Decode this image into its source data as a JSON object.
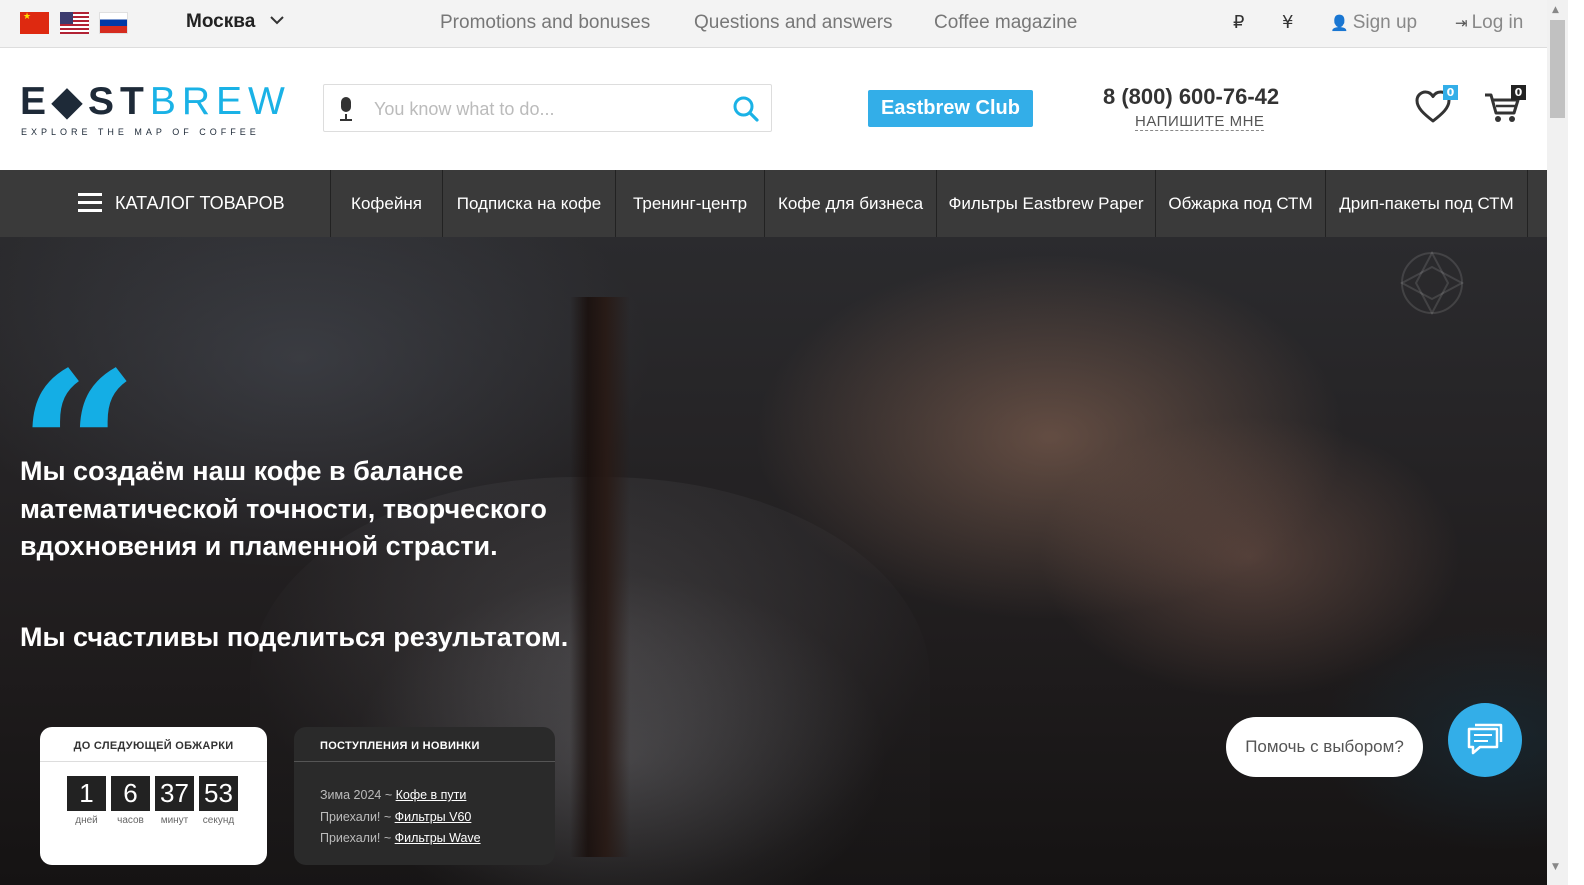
{
  "topbar": {
    "languages": [
      {
        "name": "cn-flag-icon"
      },
      {
        "name": "us-flag-icon"
      },
      {
        "name": "ru-flag-icon"
      }
    ],
    "city": "Москва",
    "links": [
      "Promotions and bonuses",
      "Questions and answers",
      "Coffee magazine"
    ],
    "currencies": [
      "₽",
      "¥"
    ],
    "signup": "Sign up",
    "login": "Log in"
  },
  "header": {
    "logo_east": "E◆ST",
    "logo_brew": "BREW",
    "logo_tagline": "EXPLORE THE MAP OF COFFEE",
    "search_placeholder": "You know what to do...",
    "club_button": "Eastbrew Club",
    "phone": "8 (800) 600-76-42",
    "write_me": "НАПИШИТЕ МНЕ",
    "wishlist_count": "0",
    "cart_count": "0"
  },
  "nav": {
    "catalog": "КАТАЛОГ ТОВАРОВ",
    "items": [
      "Кофейня",
      "Подписка на кофе",
      "Тренинг-центр",
      "Кофе для бизнеса",
      "Фильтры Eastbrew Paper",
      "Обжарка под СТМ",
      "Дрип-пакеты под СТМ"
    ]
  },
  "hero": {
    "quote_mark": "“",
    "text1": "Мы создаём наш кофе в балансе математической точности, творческого вдохновения и пламенной страсти.",
    "text2": "Мы счастливы поделиться результатом."
  },
  "roast_card": {
    "title": "ДО СЛЕДУЮЩЕЙ ОБЖАРКИ",
    "values": [
      "1",
      "6",
      "37",
      "53"
    ],
    "labels": [
      "дней",
      "часов",
      "минут",
      "секунд"
    ]
  },
  "news_card": {
    "title": "ПОСТУПЛЕНИЯ И НОВИНКИ",
    "rows": [
      {
        "prefix": "Зима 2024 ~ ",
        "link": "Кофе в пути"
      },
      {
        "prefix": "Приехали! ~ ",
        "link": "Фильтры V60"
      },
      {
        "prefix": "Приехали! ~ ",
        "link": "Фильтры Wave"
      }
    ]
  },
  "chat": {
    "bubble": "Помочь с выбором?"
  },
  "colors": {
    "accent": "#33aee8",
    "nav_bg": "#3a3a3a",
    "topbar_bg": "#f3f3f3"
  }
}
